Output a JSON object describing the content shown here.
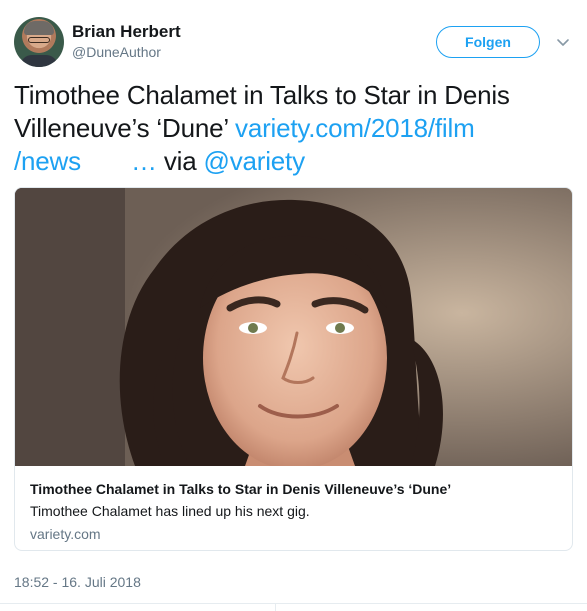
{
  "author": {
    "name": "Brian Herbert",
    "handle": "@DuneAuthor"
  },
  "follow_label": "Folgen",
  "tweet": {
    "text": "Timothee Chalamet in Talks to Star in Denis Villeneuve’s ‘Dune’",
    "link_part1": "variety.com/2018/film",
    "link_part2": "/news",
    "ellipsis": "…",
    "via": "via",
    "mention": "@variety"
  },
  "card": {
    "title": "Timothee Chalamet in Talks to Star in Denis Villeneuve’s ‘Dune’",
    "description": "Timothee Chalamet has lined up his next gig.",
    "domain": "variety.com"
  },
  "timestamp": "18:52 - 16. Juli 2018",
  "colors": {
    "accent": "#1da1f2",
    "text": "#14171a",
    "muted": "#657786",
    "border": "#e1e8ed"
  },
  "icons": {
    "caret": "chevron-down-icon"
  }
}
